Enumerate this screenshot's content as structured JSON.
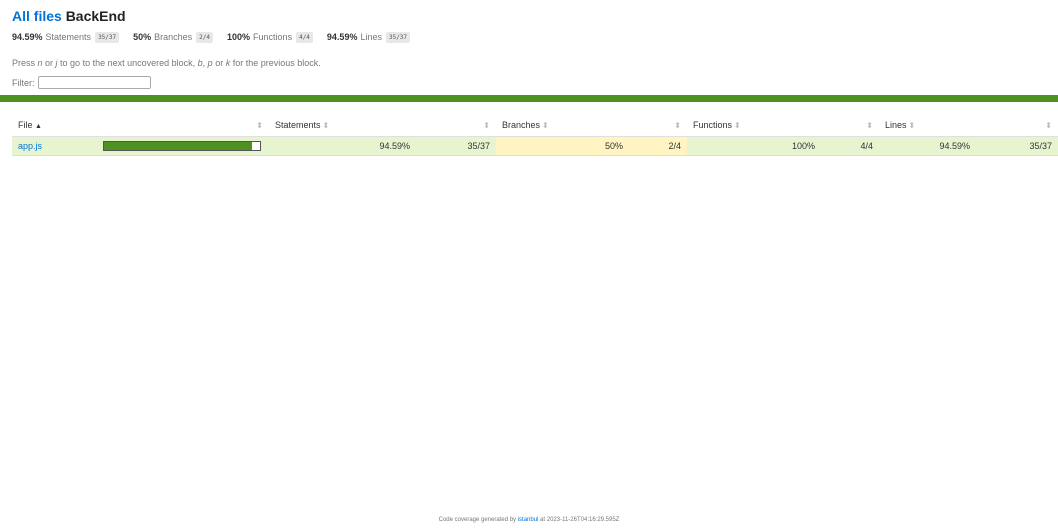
{
  "header": {
    "all_files_link": "All files",
    "project_name": "BackEnd"
  },
  "summary": [
    {
      "pct": "94.59%",
      "label": "Statements",
      "fraction": "35/37"
    },
    {
      "pct": "50%",
      "label": "Branches",
      "fraction": "2/4"
    },
    {
      "pct": "100%",
      "label": "Functions",
      "fraction": "4/4"
    },
    {
      "pct": "94.59%",
      "label": "Lines",
      "fraction": "35/37"
    }
  ],
  "help_text": {
    "p1": "Press ",
    "k1": "n",
    "p2": " or ",
    "k2": "j",
    "p3": " to go to the next uncovered block, ",
    "k3": "b",
    "p4": ", ",
    "k4": "p",
    "p5": " or ",
    "k5": "k",
    "p6": " for the previous block."
  },
  "filter": {
    "label": "Filter:",
    "value": ""
  },
  "colors": {
    "high": "#4d9221",
    "high_bg": "#e6f5d0",
    "medium_bg": "#fff4c2",
    "link": "#0074d9"
  },
  "table": {
    "columns": {
      "file": "File",
      "file_sort": "▲",
      "statements": "Statements",
      "branches": "Branches",
      "functions": "Functions",
      "lines": "Lines",
      "sorter": "⬍"
    },
    "rows": [
      {
        "file": "app.js",
        "coverage": 0.9459,
        "statements_pct": "94.59%",
        "statements_frac": "35/37",
        "branches_pct": "50%",
        "branches_frac": "2/4",
        "functions_pct": "100%",
        "functions_frac": "4/4",
        "lines_pct": "94.59%",
        "lines_frac": "35/37"
      }
    ]
  },
  "footer": {
    "prefix": "Code coverage generated by ",
    "link": "istanbul",
    "suffix": " at 2023-11-26T04:16:29.595Z"
  }
}
